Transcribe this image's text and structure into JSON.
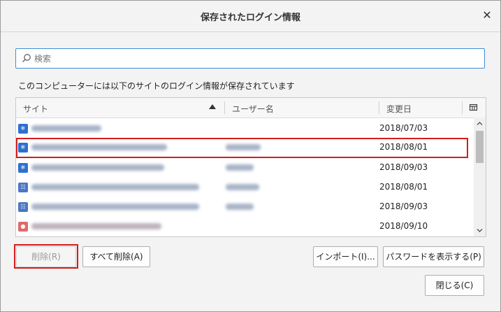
{
  "dialog": {
    "title": "保存されたログイン情報",
    "close_symbol": "✕"
  },
  "search": {
    "placeholder": "検索",
    "value": ""
  },
  "description": "このコンピューターには以下のサイトのログイン情報が保存されています",
  "table": {
    "columns": {
      "site": "サイト",
      "username": "ユーザー名",
      "changed": "変更日"
    },
    "sort_column": "site",
    "sort_direction": "ascending",
    "rows": [
      {
        "date": "2018/07/03",
        "icon_color": "#2f6fd0",
        "icon_glyph": "❄",
        "selected": false
      },
      {
        "date": "2018/08/01",
        "icon_color": "#2f6fd0",
        "icon_glyph": "❄",
        "selected": true
      },
      {
        "date": "2018/09/03",
        "icon_color": "#2f6fd0",
        "icon_glyph": "❄",
        "selected": false
      },
      {
        "date": "2018/08/01",
        "icon_color": "#4a78c7",
        "icon_glyph": "☷",
        "selected": false
      },
      {
        "date": "2018/09/03",
        "icon_color": "#4a78c7",
        "icon_glyph": "☷",
        "selected": false
      },
      {
        "date": "2018/09/10",
        "icon_color": "#e06a6a",
        "icon_glyph": "●",
        "selected": false
      }
    ]
  },
  "buttons": {
    "remove": "削除(R)",
    "remove_all": "すべて削除(A)",
    "import": "インポート(I)...",
    "show_passwords": "パスワードを表示する(P)",
    "close": "閉じる(C)"
  },
  "colors": {
    "highlight": "#d61b1b",
    "search_focus": "#3b8fd6"
  }
}
